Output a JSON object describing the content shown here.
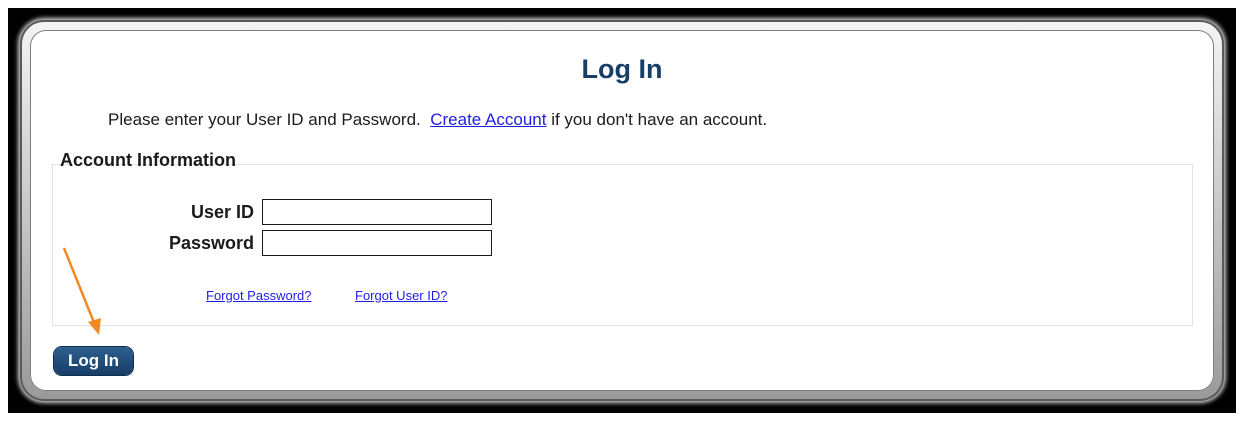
{
  "page": {
    "title": "Log In",
    "intro_before": "Please enter your User ID and Password.",
    "create_account_link": "Create Account",
    "intro_after": "if you don't have an account."
  },
  "account_info": {
    "legend": "Account Information",
    "user_id_label": "User ID",
    "user_id_value": "",
    "password_label": "Password",
    "password_value": "",
    "forgot_password_link": "Forgot Password?",
    "forgot_user_id_link": "Forgot User ID?"
  },
  "actions": {
    "login_button": "Log In"
  },
  "colors": {
    "title": "#163e67",
    "link": "#1f1fe0",
    "button": "#163e67",
    "annotation_arrow": "#f08a24"
  },
  "annotation": {
    "icon": "arrow-icon"
  }
}
